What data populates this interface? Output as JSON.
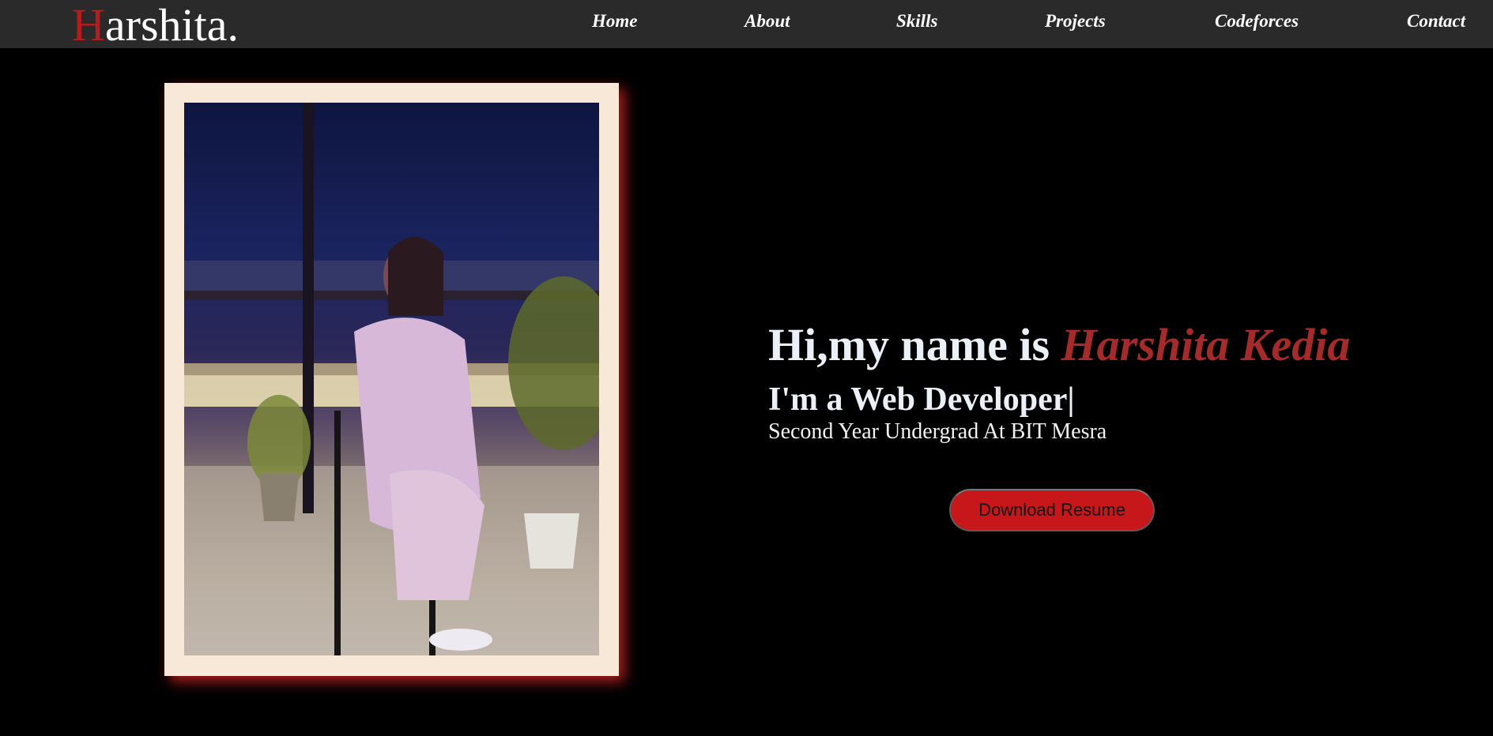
{
  "header": {
    "logo_first": "H",
    "logo_rest": "arshita."
  },
  "nav": {
    "home": "Home",
    "about": "About",
    "skills": "Skills",
    "projects": "Projects",
    "codeforces": "Codeforces",
    "contact": "Contact"
  },
  "hero": {
    "greeting_prefix": "Hi,my name is ",
    "name": "Harshita Kedia",
    "role": "I'm a Web Developer|",
    "subtitle": "Second Year Undergrad At BIT Mesra",
    "resume_label": "Download Resume"
  },
  "colors": {
    "accent": "#b71c1c",
    "button": "#c8171b",
    "navbar": "#2b2a2a",
    "frame": "#f8e8d8"
  }
}
